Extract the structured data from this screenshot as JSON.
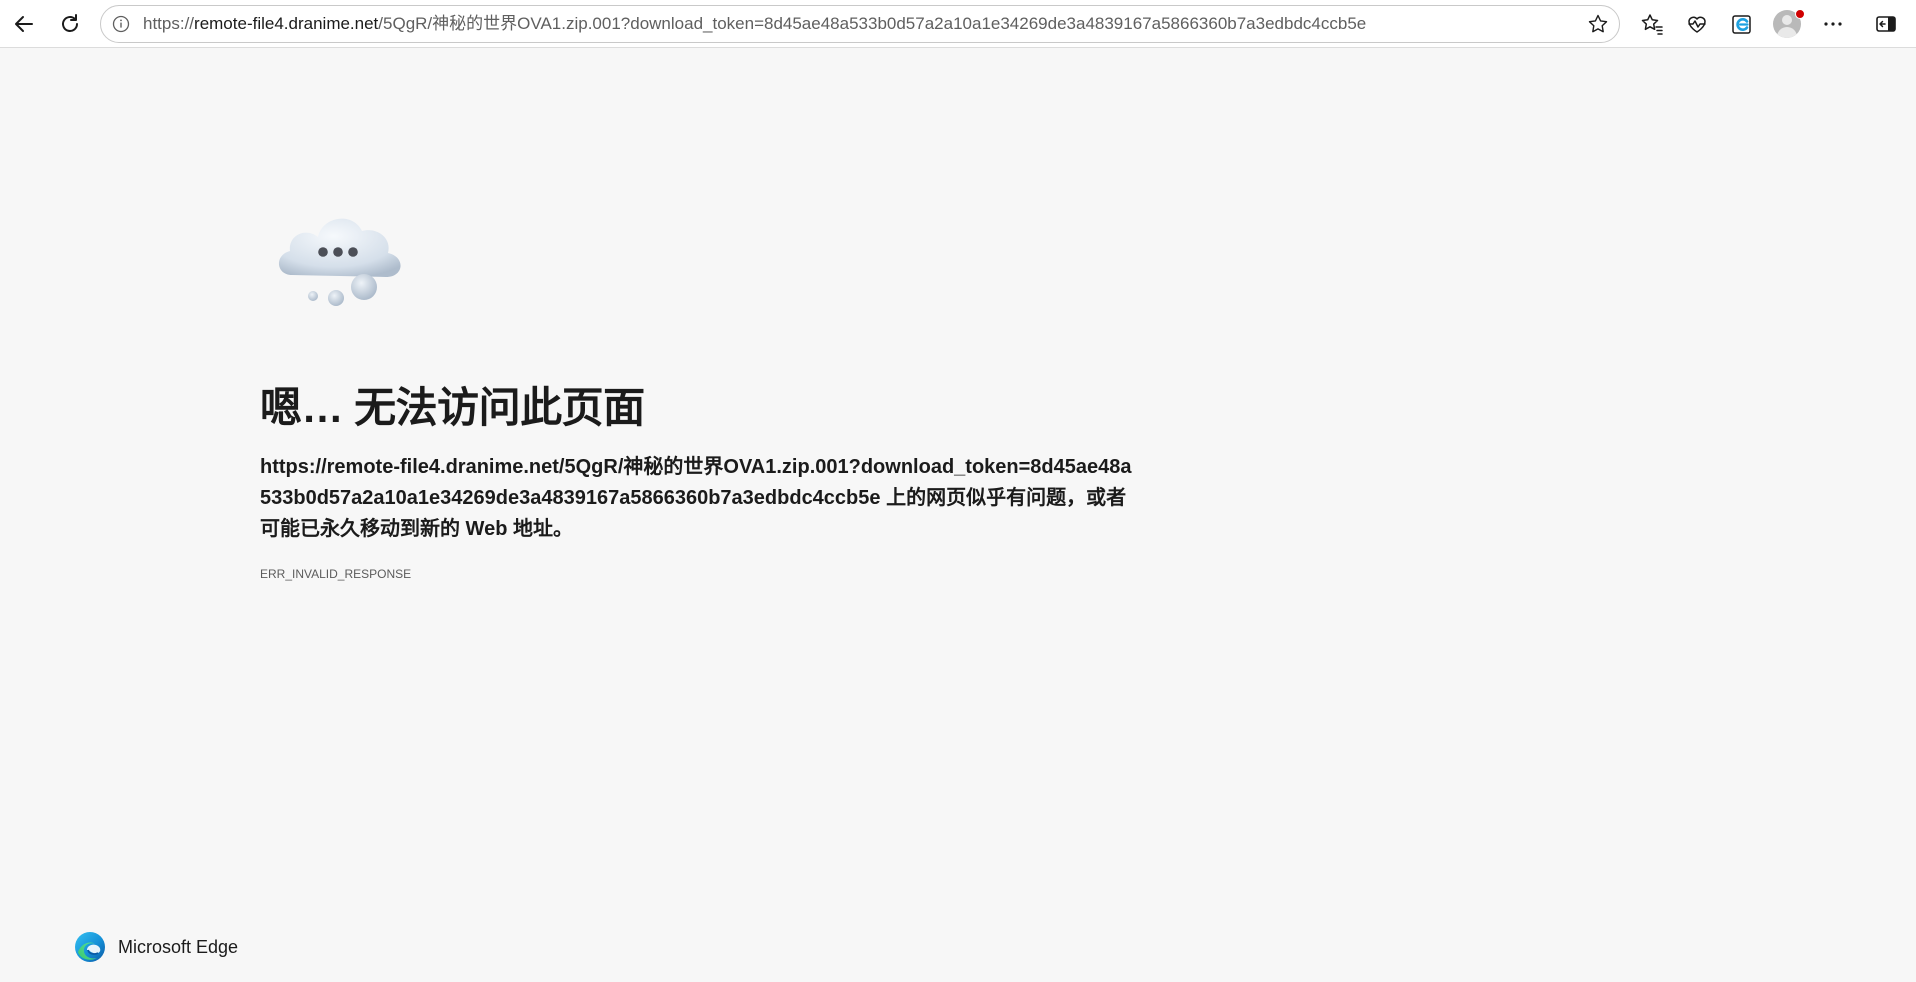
{
  "browser": {
    "address_bar": {
      "url_prefix": "https://",
      "url_host": "remote-file4.dranime.net",
      "url_path": "/5QgR/神秘的世界OVA1.zip.001?download_token=8d45ae48a533b0d57a2a10a1e34269de3a4839167a5866360b7a3edbdc4ccb5e"
    },
    "icons": {
      "back": "arrow-left-icon",
      "refresh": "refresh-icon",
      "site_info": "info-icon",
      "favorite": "star-icon",
      "favorites_list": "favorites-icon",
      "browser_essentials": "heart-pulse-icon",
      "edge_extension": "edge-e-icon",
      "profile": "avatar",
      "more": "ellipsis-icon",
      "sidebar": "sidebar-icon"
    },
    "colors": {
      "edge_blue": "#1da1e0",
      "notification_dot": "#d00000"
    }
  },
  "error_page": {
    "illustration": "cloud-icon",
    "title": "嗯… 无法访问此页面",
    "url": "https://remote-file4.dranime.net/5QgR/神秘的世界OVA1.zip.001?download_token=8d45ae48a533b0d57a2a10a1e34269de3a4839167a5866360b7a3edbdc4ccb5e",
    "message": " 上的网页似乎有问题，或者可能已永久移动到新的 Web 地址。",
    "error_code": "ERR_INVALID_RESPONSE"
  },
  "footer": {
    "brand_name": "Microsoft Edge",
    "logo": "edge-logo-icon"
  }
}
